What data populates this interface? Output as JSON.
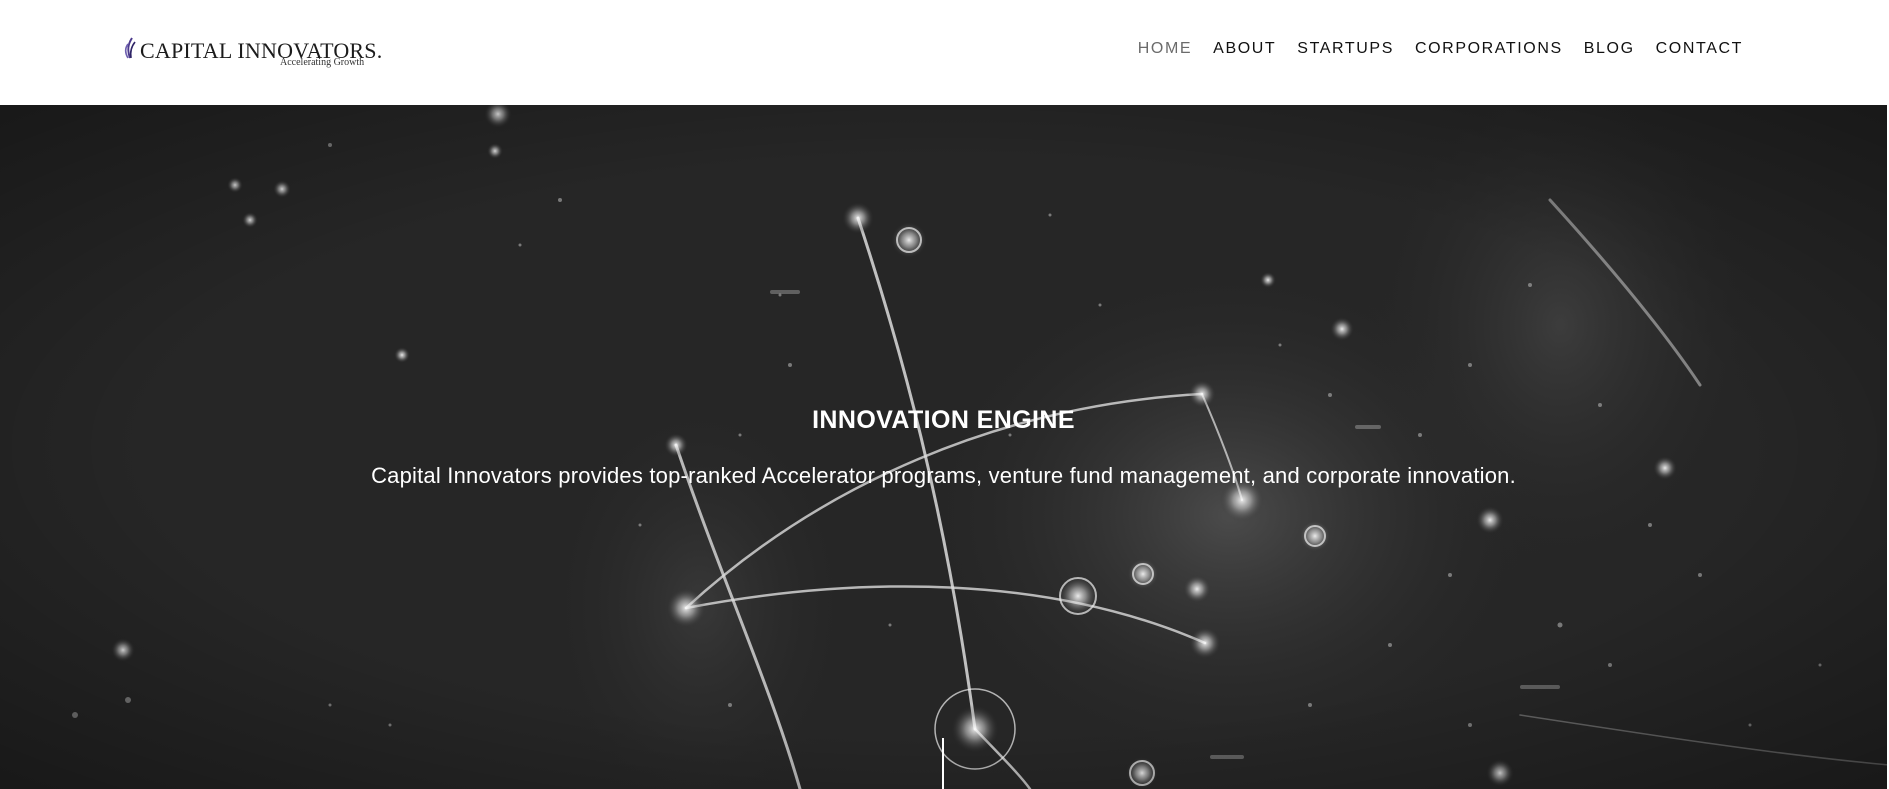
{
  "logo": {
    "name": "CAPITAL INNOVATORS.",
    "tagline": "Accelerating Growth",
    "mark_color": "#4b3a8c"
  },
  "nav": {
    "items": [
      {
        "label": "HOME",
        "active": true
      },
      {
        "label": "ABOUT",
        "active": false
      },
      {
        "label": "STARTUPS",
        "active": false
      },
      {
        "label": "CORPORATIONS",
        "active": false
      },
      {
        "label": "BLOG",
        "active": false
      },
      {
        "label": "CONTACT",
        "active": false
      }
    ]
  },
  "hero": {
    "title": "INNOVATION ENGINE",
    "subtitle": "Capital Innovators provides top-ranked Accelerator programs, venture fund management, and corporate innovation.",
    "background_color": "#262626",
    "glow_color": "#ffffff"
  }
}
